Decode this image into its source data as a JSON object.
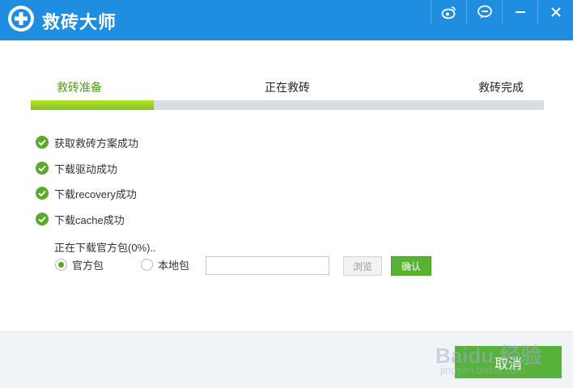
{
  "window": {
    "title": "救砖大师",
    "title_bar_color": "#1f8de0",
    "controls": [
      {
        "name": "weibo-icon"
      },
      {
        "name": "feedback-icon"
      },
      {
        "name": "minimize-icon"
      },
      {
        "name": "close-icon"
      }
    ]
  },
  "steps": [
    {
      "label": "救砖准备",
      "active": true
    },
    {
      "label": "正在救砖",
      "active": false
    },
    {
      "label": "救砖完成",
      "active": false
    }
  ],
  "progress": {
    "value": 0.24,
    "fill_color": "#9ad225"
  },
  "tasks": [
    {
      "label": "获取救砖方案成功",
      "status": "done"
    },
    {
      "label": "下载驱动成功",
      "status": "done"
    },
    {
      "label": "下载recovery成功",
      "status": "done"
    },
    {
      "label": "下载cache成功",
      "status": "done"
    }
  ],
  "download": {
    "status_text": "正在下载官方包(0%)..",
    "options": [
      {
        "label": "官方包",
        "selected": true
      },
      {
        "label": "本地包",
        "selected": false
      }
    ],
    "path_value": "",
    "browse_label": "浏览",
    "confirm_label": "确认"
  },
  "footer": {
    "cancel_label": "取消"
  },
  "watermark": {
    "brand": "Baidu 经验",
    "url": "jingyan.baidu.com"
  },
  "colors": {
    "accent_green": "#56b23a",
    "check_green": "#5aaa2a"
  }
}
